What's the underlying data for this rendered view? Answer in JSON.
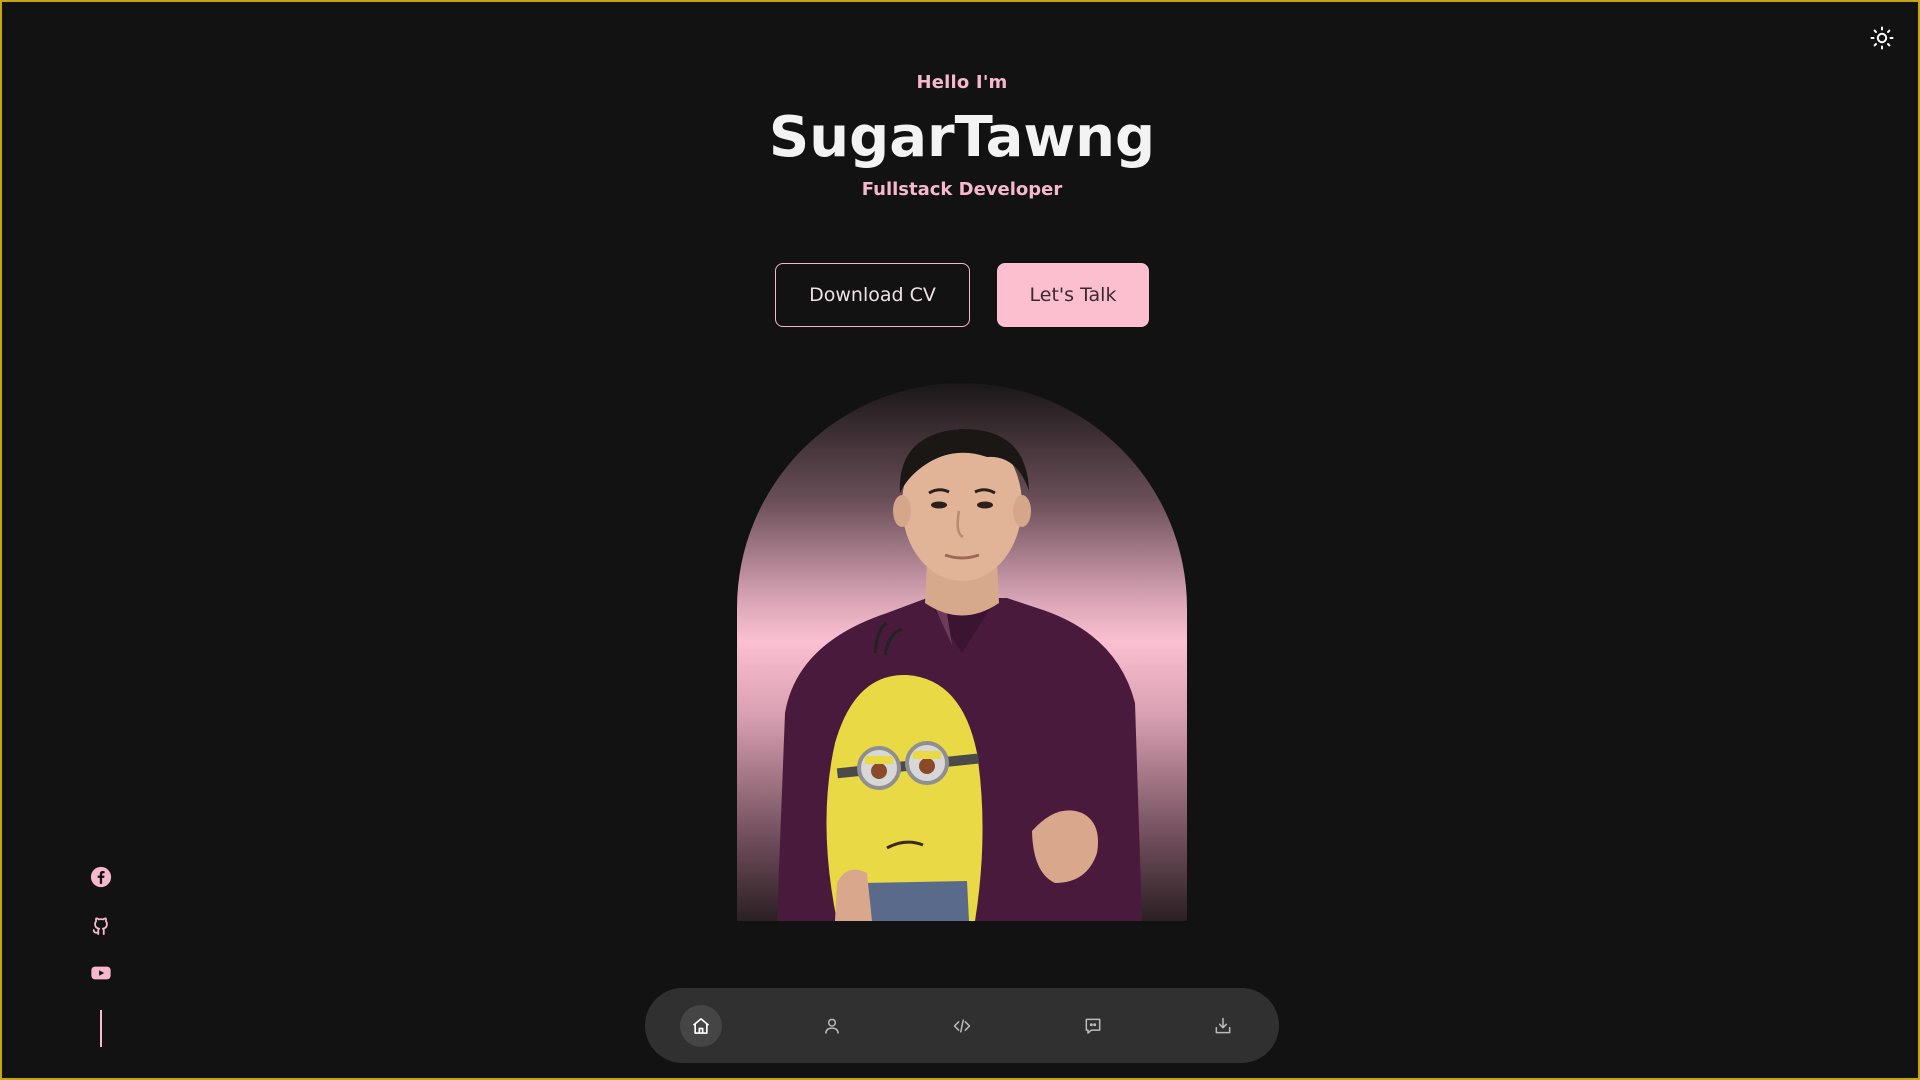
{
  "header": {
    "theme_toggle_icon": "sun-icon"
  },
  "hero": {
    "greeting": "Hello I'm",
    "name": "SugarTawng",
    "role": "Fullstack Developer"
  },
  "actions": {
    "download_cv_label": "Download CV",
    "lets_talk_label": "Let's Talk"
  },
  "socials": [
    {
      "icon": "facebook-icon"
    },
    {
      "icon": "github-icon"
    },
    {
      "icon": "youtube-icon"
    }
  ],
  "nav": {
    "items": [
      {
        "icon": "home-icon",
        "active": true
      },
      {
        "icon": "user-icon",
        "active": false
      },
      {
        "icon": "code-icon",
        "active": false
      },
      {
        "icon": "chat-icon",
        "active": false
      },
      {
        "icon": "download-icon",
        "active": false
      }
    ]
  },
  "colors": {
    "background": "#121212",
    "accent": "#fbbfd0",
    "text": "#f3f3f3",
    "nav_bg": "#303030"
  }
}
